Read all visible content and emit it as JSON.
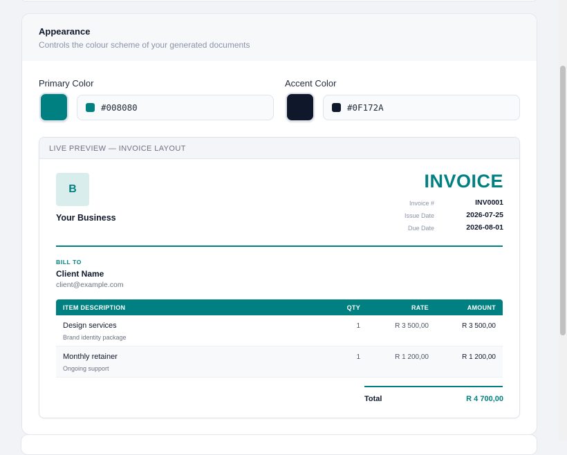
{
  "section": {
    "title": "Appearance",
    "subtitle": "Controls the colour scheme of your generated documents"
  },
  "primary_color": {
    "label": "Primary Color",
    "value": "#008080"
  },
  "accent_color": {
    "label": "Accent Color",
    "value": "#0F172A"
  },
  "preview": {
    "header": "LIVE PREVIEW — INVOICE LAYOUT",
    "logo_letter": "B",
    "business_name": "Your Business",
    "invoice_title": "INVOICE",
    "meta": [
      {
        "label": "Invoice #",
        "value": "INV0001"
      },
      {
        "label": "Issue Date",
        "value": "2026-07-25"
      },
      {
        "label": "Due Date",
        "value": "2026-08-01"
      }
    ],
    "bill_to_label": "BILL TO",
    "client_name": "Client Name",
    "client_email": "client@example.com",
    "columns": {
      "description": "ITEM DESCRIPTION",
      "qty": "QTY",
      "rate": "RATE",
      "amount": "AMOUNT"
    },
    "items": [
      {
        "name": "Design services",
        "desc": "Brand identity package",
        "qty": "1",
        "rate": "R 3 500,00",
        "amount": "R 3 500,00"
      },
      {
        "name": "Monthly retainer",
        "desc": "Ongoing support",
        "qty": "1",
        "rate": "R 1 200,00",
        "amount": "R 1 200,00"
      }
    ],
    "total_label": "Total",
    "total_value": "R 4 700,00"
  },
  "colors": {
    "primary": "#008080",
    "accent": "#0F172A",
    "logo_bg": "#d9eeec"
  }
}
